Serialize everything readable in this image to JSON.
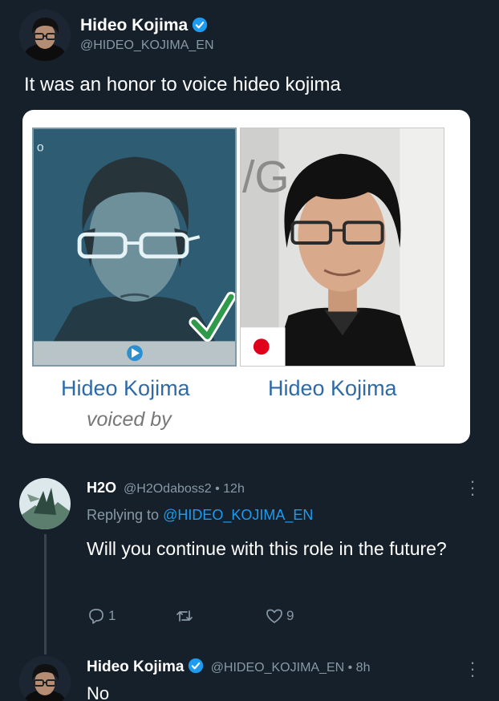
{
  "tweet": {
    "author_name": "Hideo Kojima",
    "author_handle": "@HIDEO_KOJIMA_EN",
    "text": "It was an honor to voice hideo kojima"
  },
  "media": {
    "left_name": "Hideo Kojima",
    "left_caption": "voiced by",
    "right_name": "Hideo Kojima",
    "left_corner_glyph": "o",
    "right_bg_letters": "/G",
    "check_color": "#2e9a4a",
    "flag_color": "#e0001b"
  },
  "reply": {
    "name": "H2O",
    "meta": "@H2Odaboss2 • 12h",
    "replying_prefix": "Replying to",
    "replying_to": "@HIDEO_KOJIMA_EN",
    "text": "Will you continue with this role in the future?",
    "reply_count": "1",
    "retweet_count": "",
    "like_count": "9"
  },
  "bottom_reply": {
    "name": "Hideo Kojima",
    "meta": "@HIDEO_KOJIMA_EN • 8h",
    "text": "No"
  },
  "colors": {
    "background": "#15202b",
    "secondary_text": "#8899a6",
    "link": "#1d9bf0",
    "verified": "#1d9bf0"
  },
  "icons": {
    "verified": "verified-badge-icon",
    "more": "more-dots-icon",
    "reply": "comment-icon",
    "retweet": "retweet-icon",
    "like": "heart-icon",
    "play": "play-icon",
    "checkmark": "checkmark-icon",
    "flag": "japan-flag-icon"
  }
}
